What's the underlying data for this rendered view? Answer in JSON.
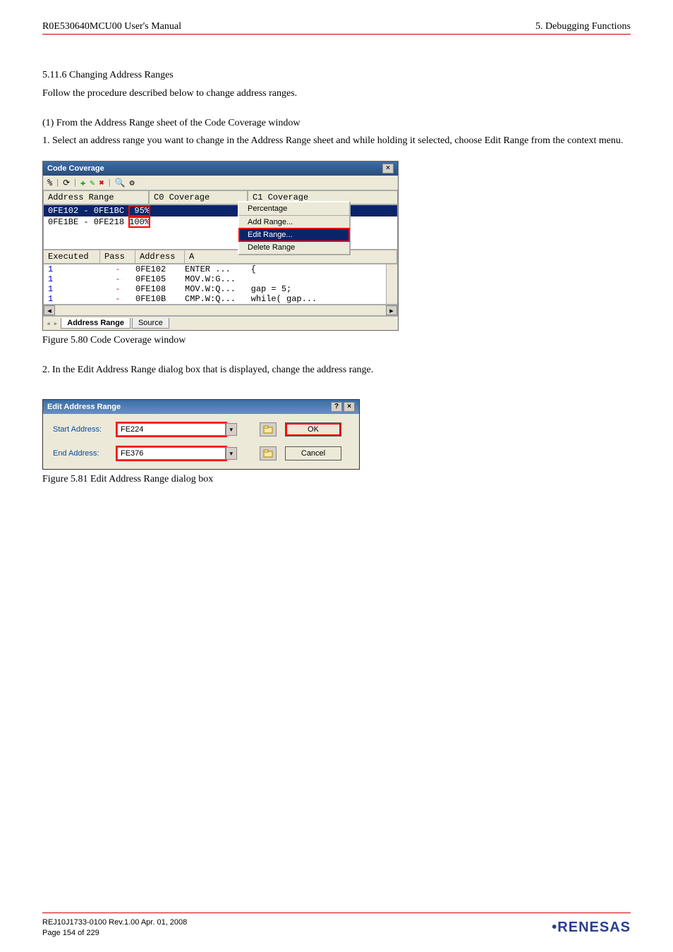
{
  "header": {
    "left": "R0E530640MCU00 User's Manual",
    "right": "5. Debugging Functions"
  },
  "section": {
    "heading": "5.11.6   Changing Address Ranges",
    "intro": "Follow the procedure described below to change address ranges.",
    "sub1": "(1) From the Address Range sheet of the Code Coverage window",
    "step1": "1. Select an address range you want to change in the Address Range sheet and while holding it selected, choose Edit Range from the context menu."
  },
  "codecov": {
    "title": "Code Coverage",
    "close_x": "×",
    "toolbar": {
      "pct": "%",
      "refresh": "⟳",
      "add": "✚",
      "del": "✖",
      "find": "🔍",
      "cfg": "⚙"
    },
    "cols": {
      "addr": "Address Range",
      "c0": "C0 Coverage",
      "c1": "C1 Coverage"
    },
    "rows": [
      {
        "range": "0FE102 - 0FE1BC",
        "pct": " 95%"
      },
      {
        "range": "0FE1BE - 0FE218",
        "pct": "100%"
      }
    ],
    "menu": {
      "percentage": "Percentage",
      "add": "Add Range...",
      "edit": "Edit Range...",
      "del": "Delete Range"
    },
    "disasm_cols": {
      "exec": "Executed",
      "pass": "Pass",
      "addr": "Address",
      "asm": "A"
    },
    "disasm": [
      {
        "e": "1",
        "p": "-",
        "a": "0FE102",
        "s": "ENTER ...    {"
      },
      {
        "e": "1",
        "p": "-",
        "a": "0FE105",
        "s": "MOV.W:G..."
      },
      {
        "e": "1",
        "p": "-",
        "a": "0FE108",
        "s": "MOV.W:Q...   gap = 5;"
      },
      {
        "e": "1",
        "p": "-",
        "a": "0FE10B",
        "s": "CMP.W:Q...   while( gap..."
      }
    ],
    "tabs": {
      "addr": "Address Range",
      "src": "Source"
    }
  },
  "fig80": "Figure 5.80 Code Coverage window",
  "step2": "2. In the Edit Address Range dialog box that is displayed, change the address range.",
  "dialog": {
    "title": "Edit Address Range",
    "help": "?",
    "close": "×",
    "start_lbl": "Start Address:",
    "start_val": "FE224",
    "end_lbl": "End Address:",
    "end_val": "FE376",
    "ok": "OK",
    "cancel": "Cancel"
  },
  "fig81": "Figure 5.81 Edit Address Range dialog box",
  "footer": {
    "line1": "REJ10J1733-0100  Rev.1.00  Apr. 01, 2008",
    "line2": "Page 154 of 229",
    "logo": "RENESAS"
  }
}
